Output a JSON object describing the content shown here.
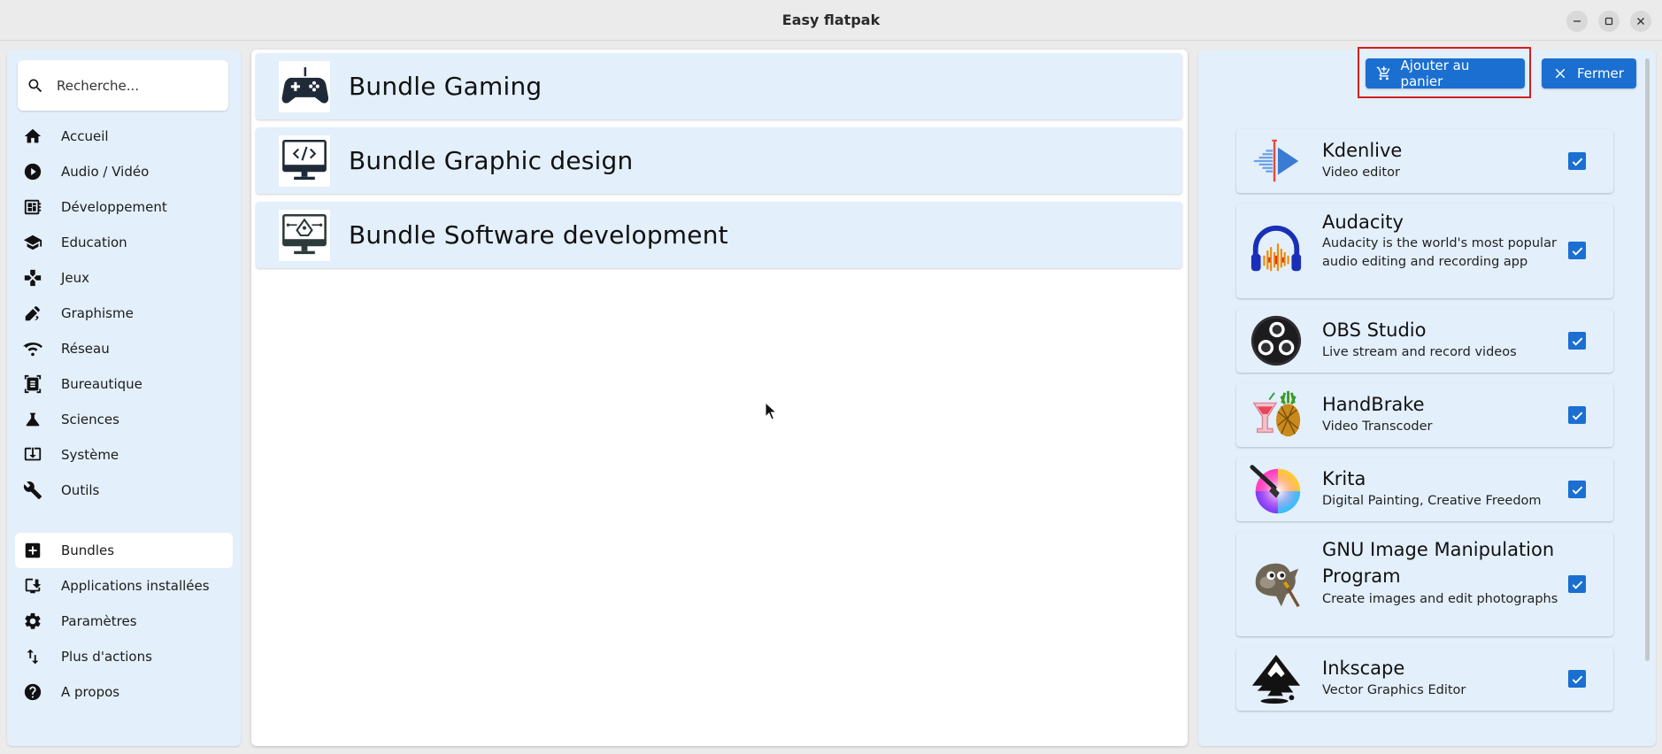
{
  "window": {
    "title": "Easy flatpak"
  },
  "search": {
    "placeholder": "Recherche..."
  },
  "sidebar": {
    "categories": [
      {
        "label": "Accueil",
        "icon": "home-icon"
      },
      {
        "label": "Audio / Vidéo",
        "icon": "play-circle-icon"
      },
      {
        "label": "Développement",
        "icon": "developer-board-icon"
      },
      {
        "label": "Education",
        "icon": "school-icon"
      },
      {
        "label": "Jeux",
        "icon": "gamepad-icon"
      },
      {
        "label": "Graphisme",
        "icon": "draw-icon"
      },
      {
        "label": "Réseau",
        "icon": "network-icon"
      },
      {
        "label": "Bureautique",
        "icon": "document-scanner-icon"
      },
      {
        "label": "Sciences",
        "icon": "flask-icon"
      },
      {
        "label": "Système",
        "icon": "system-update-icon"
      },
      {
        "label": "Outils",
        "icon": "wrench-icon"
      }
    ],
    "actions": [
      {
        "label": "Bundles",
        "icon": "add-box-icon",
        "active": true
      },
      {
        "label": "Applications installées",
        "icon": "install-desktop-icon"
      },
      {
        "label": "Paramètres",
        "icon": "gear-icon"
      },
      {
        "label": "Plus d'actions",
        "icon": "swap-vert-icon"
      },
      {
        "label": "A propos",
        "icon": "help-icon"
      }
    ]
  },
  "bundles": [
    {
      "title": "Bundle Gaming",
      "icon": "gamepad-icon"
    },
    {
      "title": "Bundle Graphic design",
      "icon": "monitor-code-icon"
    },
    {
      "title": "Bundle Software development",
      "icon": "monitor-pen-icon"
    }
  ],
  "detail": {
    "add_to_cart_label": "Ajouter au panier",
    "close_label": "Fermer",
    "apps": [
      {
        "name": "Kdenlive",
        "description": "Video editor",
        "checked": true,
        "icon": "kdenlive-icon"
      },
      {
        "name": "Audacity",
        "description": "Audacity is the world's most popular audio editing and recording app",
        "checked": true,
        "icon": "audacity-icon"
      },
      {
        "name": "OBS Studio",
        "description": "Live stream and record videos",
        "checked": true,
        "icon": "obs-icon"
      },
      {
        "name": "HandBrake",
        "description": "Video Transcoder",
        "checked": true,
        "icon": "handbrake-icon"
      },
      {
        "name": "Krita",
        "description": "Digital Painting, Creative Freedom",
        "checked": true,
        "icon": "krita-icon"
      },
      {
        "name": "GNU Image Manipulation Program",
        "description": "Create images and edit photographs",
        "checked": true,
        "icon": "gimp-icon"
      },
      {
        "name": "Inkscape",
        "description": "Vector Graphics Editor",
        "checked": true,
        "icon": "inkscape-icon"
      }
    ]
  },
  "colors": {
    "accent": "#1a6fd1",
    "panel": "#e3effa",
    "highlight": "#d31f1f"
  }
}
